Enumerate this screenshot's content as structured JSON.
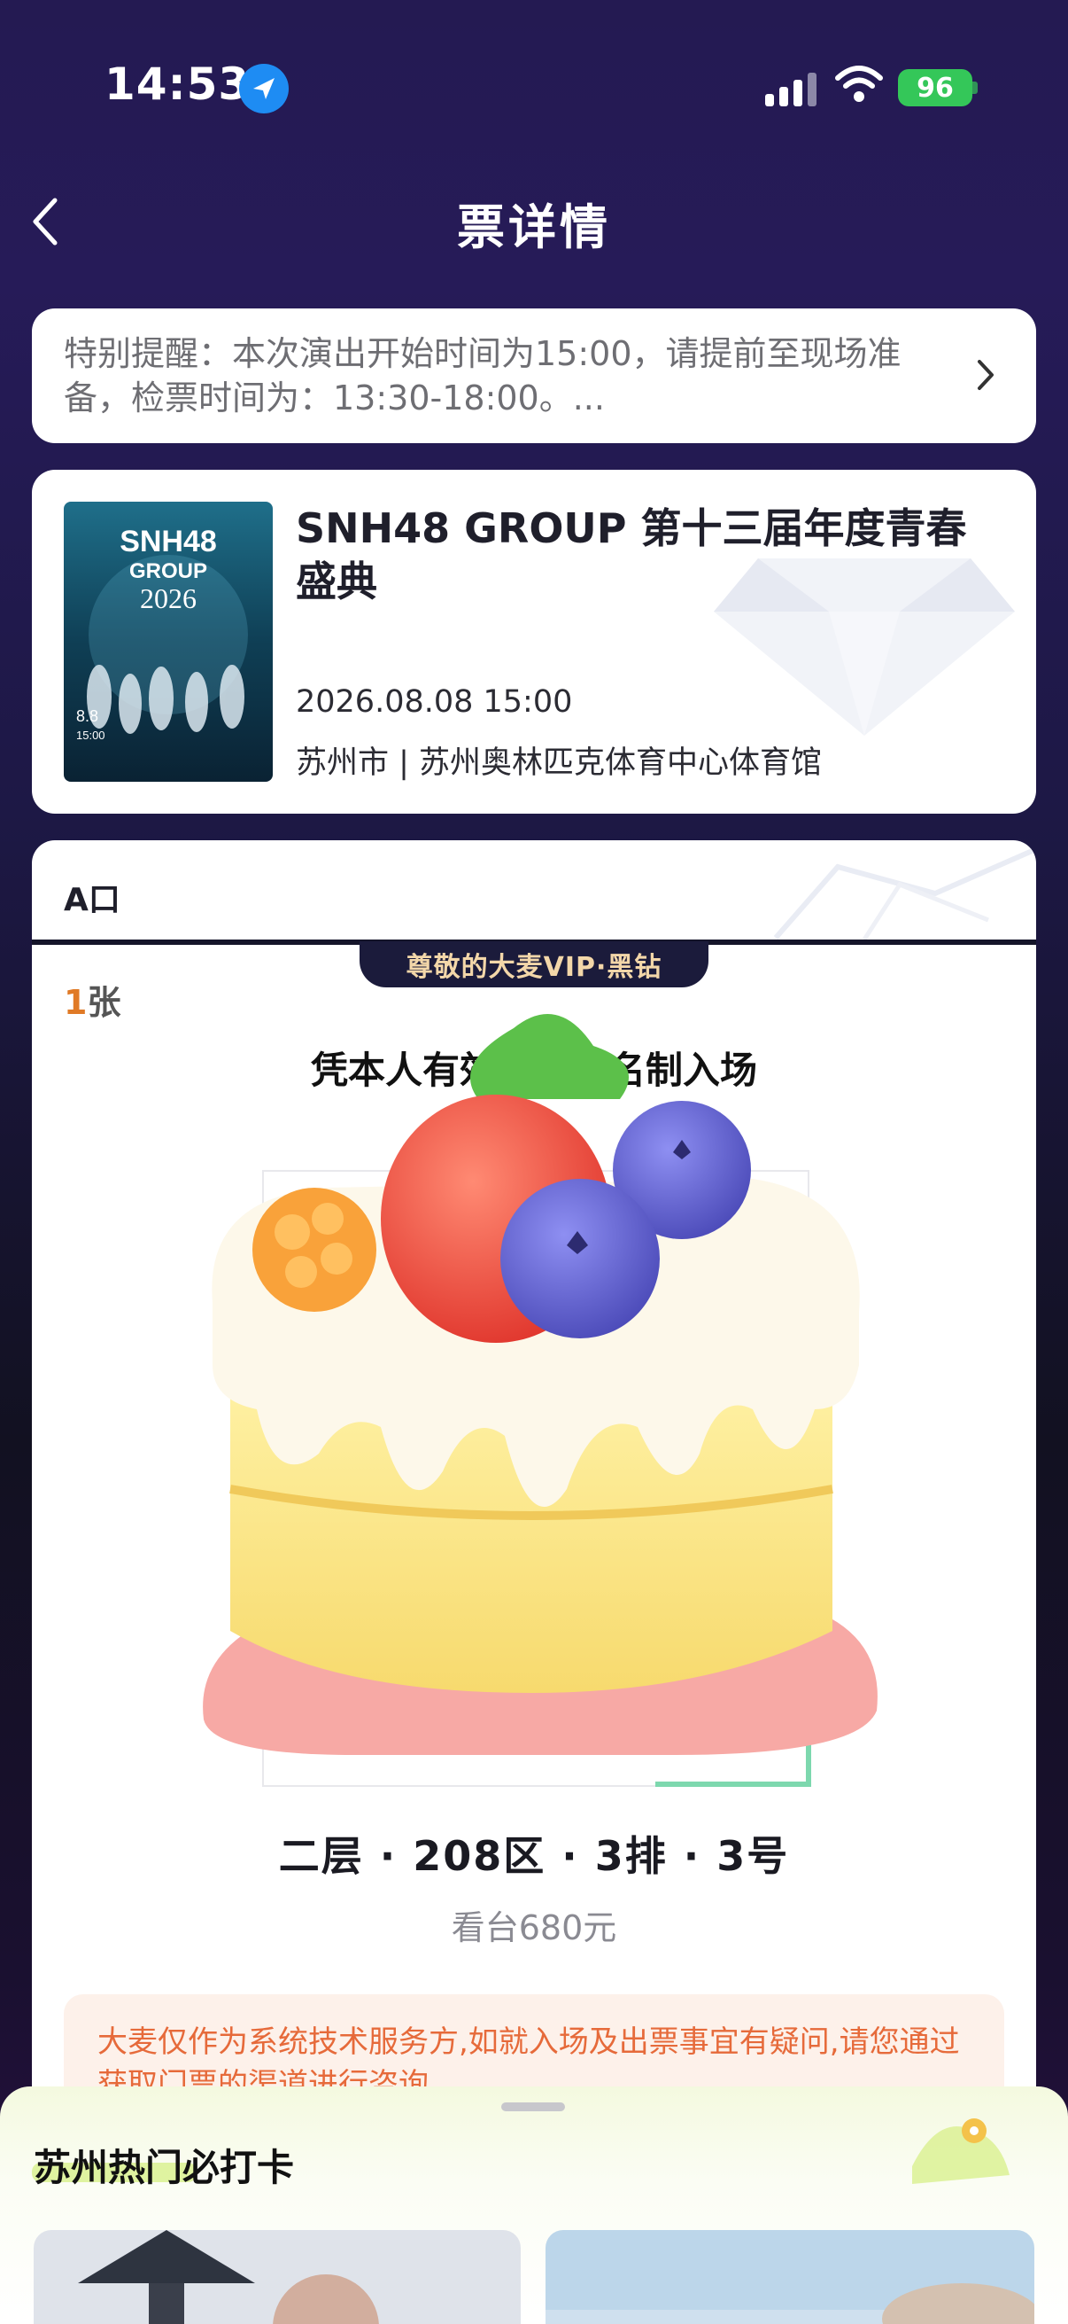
{
  "status_bar": {
    "time": "14:53",
    "battery": "96"
  },
  "nav": {
    "title": "票详情"
  },
  "notice": {
    "text": "特别提醒：本次演出开始时间为15:00，请提前至现场准备，检票时间为：13:30-18:00。..."
  },
  "event": {
    "title": "SNH48 GROUP 第十三届年度青春盛典",
    "date": "2026.08.08 15:00",
    "venue": "苏州市 | 苏州奥林匹克体育中心体育馆",
    "poster": {
      "brand": "SNH48",
      "group": "GROUP",
      "year": "2026",
      "date": "8.8",
      "time": "15:00"
    }
  },
  "ticket": {
    "gate": "A口",
    "vip_badge": "尊敬的大麦VIP·黑钻",
    "count_number": "1",
    "count_unit": "张",
    "entry_rule": "凭本人有效证件实名制入场",
    "seat": "二层 · 208区 · 3排 · 3号",
    "price": "看台680元",
    "disclaimer": "大麦仅作为系统技术服务方,如就入场及出票事宜有疑问,请您通过获取门票的渠道进行咨询。"
  },
  "sheet": {
    "title": "苏州热门必打卡"
  },
  "colors": {
    "accent_orange": "#e07a26",
    "disclaimer_red": "#e66a3a",
    "vip_gold": "#f3d7a9",
    "battery_green": "#34c759"
  },
  "icons": [
    "location-arrow-icon",
    "signal-icon",
    "wifi-icon",
    "back-chevron-icon",
    "chevron-right-icon",
    "cake-sticker-icon",
    "map-pin-icon"
  ]
}
